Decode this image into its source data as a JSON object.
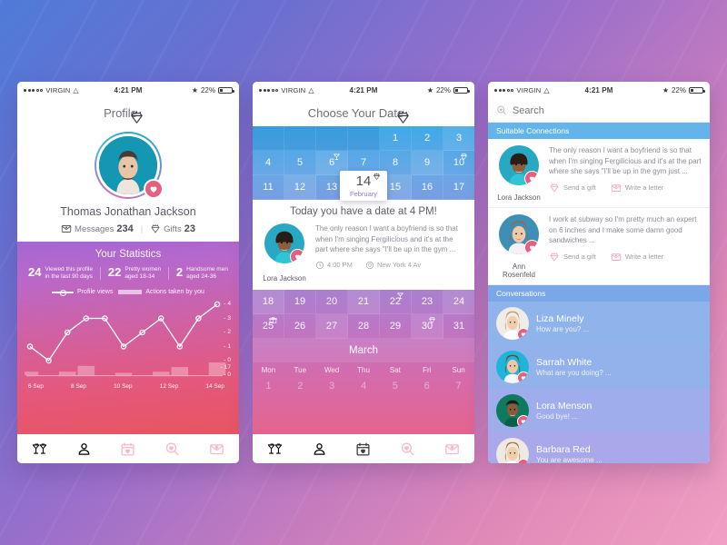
{
  "statusbar": {
    "carrier": "VIRGIN",
    "time": "4:21 PM",
    "battery": "22%"
  },
  "phone1": {
    "title": "Profile",
    "name": "Thomas Jonathan Jackson",
    "messages_label": "Messages",
    "messages_count": "234",
    "gifts_label": "Gifts",
    "gifts_count": "23",
    "stats_title": "Your Statistics",
    "stats": [
      {
        "num": "24",
        "line1": "Viewed this profile",
        "line2": "in the last 90 days"
      },
      {
        "num": "22",
        "line1": "Pretty women",
        "line2": "aged 18-34"
      },
      {
        "num": "2",
        "line1": "Handsome men",
        "line2": "aged 24-36"
      }
    ],
    "legend_line": "Profile views",
    "legend_bar": "Actions taken by you"
  },
  "chart_data": {
    "type": "line",
    "title": "Your Statistics",
    "xlabel": "",
    "ylabel": "",
    "ylim": [
      0,
      4
    ],
    "yticks": [
      "4",
      "3",
      "2",
      "1",
      "0",
      "17",
      "0"
    ],
    "grid": false,
    "legend_position": "top",
    "x": [
      1,
      2,
      3,
      4,
      5,
      6,
      7,
      8,
      9,
      10,
      11
    ],
    "categories": [
      "6 Sep",
      "",
      "8 Sep",
      "",
      "10 Sep",
      "",
      "12 Sep",
      "",
      "14 Sep",
      "",
      ""
    ],
    "tick_labels": [
      "6 Sep",
      "8 Sep",
      "10 Sep",
      "12 Sep",
      "14 Sep"
    ],
    "series": [
      {
        "name": "Profile views",
        "type": "line",
        "values": [
          1,
          0,
          2,
          3,
          3,
          1,
          2,
          3,
          1,
          3,
          4
        ]
      },
      {
        "name": "Actions taken by you",
        "type": "bar",
        "values": [
          3,
          0,
          3,
          8,
          0,
          2,
          0,
          3,
          7,
          0,
          11
        ]
      }
    ]
  },
  "phone2": {
    "title": "Choose Your Date",
    "weeks": [
      [
        {
          "d": "",
          "empty": true
        },
        {
          "d": "",
          "empty": true
        },
        {
          "d": "",
          "empty": true
        },
        {
          "d": "",
          "empty": true
        },
        {
          "d": "1"
        },
        {
          "d": "2"
        },
        {
          "d": "3"
        }
      ],
      [
        {
          "d": "4"
        },
        {
          "d": "5"
        },
        {
          "d": "6",
          "mark": "cocktail"
        },
        {
          "d": "7"
        },
        {
          "d": "8"
        },
        {
          "d": "9"
        },
        {
          "d": "10",
          "mark": "diamond"
        }
      ],
      [
        {
          "d": "11"
        },
        {
          "d": "12"
        },
        {
          "d": "13"
        },
        {
          "d": "14",
          "selected": true
        },
        {
          "d": "15"
        },
        {
          "d": "16"
        },
        {
          "d": "17"
        }
      ]
    ],
    "selected_day": "14",
    "selected_month": "February",
    "weeks_after": [
      [
        {
          "d": "18"
        },
        {
          "d": "19"
        },
        {
          "d": "20"
        },
        {
          "d": "21"
        },
        {
          "d": "22",
          "mark": "cocktail"
        },
        {
          "d": "23"
        },
        {
          "d": "24"
        }
      ],
      [
        {
          "d": "25",
          "mark": "gift"
        },
        {
          "d": "26"
        },
        {
          "d": "27"
        },
        {
          "d": "28"
        },
        {
          "d": "29"
        },
        {
          "d": "30",
          "mark": "diamond"
        },
        {
          "d": "31"
        }
      ]
    ],
    "date_card": {
      "title": "Today you have a date at 4 PM!",
      "person": "Lora Jackson",
      "text": "The only reason I want a boyfriend is so that when I'm singing Fergilicious and it's at the part where she says \"I'll be up in the gym ...",
      "time": "4:00 PM",
      "place": "New York 4 Av"
    },
    "month_label": "March",
    "weekdays": [
      "Mon",
      "Tue",
      "Wed",
      "Thu",
      "Sat",
      "Fri",
      "Sun"
    ],
    "next_days": [
      "1",
      "2",
      "3",
      "4",
      "5",
      "6",
      "7"
    ]
  },
  "phone3": {
    "search_placeholder": "Search",
    "section_connections": "Suitable Connections",
    "section_conversations": "Conversations",
    "action_gift": "Send a gift",
    "action_letter": "Write a letter",
    "connections": [
      {
        "name": "Lora Jackson",
        "text": "The only reason I want a boyfriend is so that when I'm singing Fergilicious and it's at the part where she says \"I'll be up in the gym just ..."
      },
      {
        "name": "Ann Rosenfeld",
        "text": "I work at subway so I'm pretty much an expert on 6 inches and I make some damn good sandwiches ..."
      }
    ],
    "conversations": [
      {
        "name": "Liza Minely",
        "msg": "How are you? ..."
      },
      {
        "name": "Sarrah White",
        "msg": "What are you doing? ..."
      },
      {
        "name": "Lora Menson",
        "msg": "Good bye! ..."
      },
      {
        "name": "Barbara Red",
        "msg": "You are awesome ..."
      }
    ]
  },
  "tabs": [
    {
      "name": "cocktail",
      "active1": false,
      "active2": false,
      "active3": false
    },
    {
      "name": "profile",
      "active1": true,
      "active2": false,
      "active3": false
    },
    {
      "name": "calendar",
      "active1": false,
      "active2": true,
      "active3": false
    },
    {
      "name": "search",
      "active1": false,
      "active2": false,
      "active3": true
    },
    {
      "name": "messages",
      "active1": false,
      "active2": false,
      "active3": false
    }
  ],
  "colors": {
    "accent_pink": "#e4607f",
    "blue": "#63b4ea",
    "purple": "#a566d4"
  }
}
